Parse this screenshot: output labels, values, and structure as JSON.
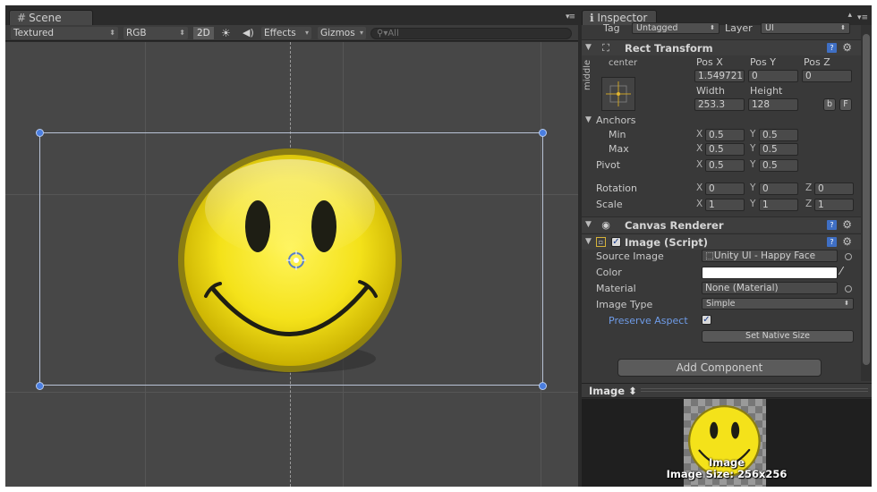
{
  "scene": {
    "tab_label": "Scene",
    "toolbar": {
      "shading_mode": "Textured",
      "render_mode": "RGB",
      "mode_2d": "2D",
      "effects_label": "Effects",
      "gizmos_label": "Gizmos",
      "search_placeholder": "All"
    }
  },
  "inspector": {
    "tab_label": "Inspector",
    "tag_label": "Tag",
    "tag_value": "Untagged",
    "layer_label": "Layer",
    "layer_value": "UI",
    "rect_transform": {
      "title": "Rect Transform",
      "anchor_h": "center",
      "anchor_v": "middle",
      "pos_x_label": "Pos X",
      "pos_y_label": "Pos Y",
      "pos_z_label": "Pos Z",
      "pos_x": "1.549721",
      "pos_y": "0",
      "pos_z": "0",
      "width_label": "Width",
      "height_label": "Height",
      "width": "253.3",
      "height": "128",
      "blueprint_btn": "b",
      "raw_btn": "F",
      "anchors_label": "Anchors",
      "min_label": "Min",
      "max_label": "Max",
      "min_x": "0.5",
      "min_y": "0.5",
      "max_x": "0.5",
      "max_y": "0.5",
      "pivot_label": "Pivot",
      "pivot_x": "0.5",
      "pivot_y": "0.5",
      "rotation_label": "Rotation",
      "rot_x": "0",
      "rot_y": "0",
      "rot_z": "0",
      "scale_label": "Scale",
      "scale_x": "1",
      "scale_y": "1",
      "scale_z": "1",
      "axis_x": "X",
      "axis_y": "Y",
      "axis_z": "Z"
    },
    "canvas_renderer": {
      "title": "Canvas Renderer"
    },
    "image_script": {
      "title": "Image (Script)",
      "source_image_label": "Source Image",
      "source_image_value": "Unity UI - Happy Face",
      "color_label": "Color",
      "color_value": "#ffffff",
      "material_label": "Material",
      "material_value": "None (Material)",
      "image_type_label": "Image Type",
      "image_type_value": "Simple",
      "preserve_aspect_label": "Preserve Aspect",
      "preserve_aspect_checked": true,
      "set_native_size_label": "Set Native Size"
    },
    "add_component_label": "Add Component"
  },
  "preview": {
    "title": "Image",
    "caption_name": "Image",
    "caption_size": "Image Size: 256x256"
  },
  "colors": {
    "accent_blue": "#4a7ee0",
    "smiley_yellow": "#f4e21a",
    "panel_dark": "#393939"
  }
}
